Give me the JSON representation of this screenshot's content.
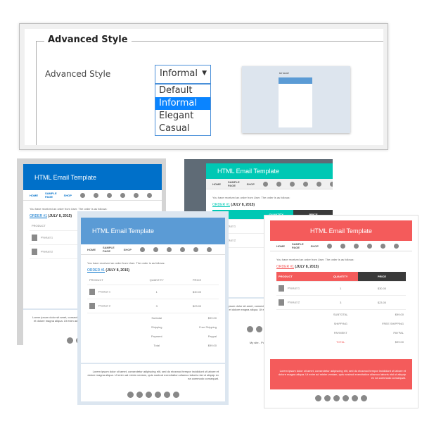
{
  "settings": {
    "legend": "Advanced Style",
    "label": "Advanced Style",
    "selected": "Informal",
    "options": [
      "Default",
      "Informal",
      "Elegant",
      "Casual"
    ],
    "preview_shop": "MY SHOP"
  },
  "email": {
    "title": "HTML Email Template",
    "nav": [
      "HOME",
      "SAMPLE PAGE",
      "SHOP"
    ],
    "social_icons": [
      "facebook-icon",
      "twitter-icon",
      "google-plus-icon",
      "email-icon",
      "instagram-icon",
      "flickr-icon"
    ],
    "intro": "You have received an order from User. The order is as follows:",
    "order_link": "ORDER #1",
    "order_date": "(JULY 8, 2015)",
    "headers": [
      "PRODUCT",
      "QUANTITY",
      "PRICE"
    ],
    "products": [
      {
        "name": "Product 1",
        "qty": "1",
        "price": "$30.00"
      },
      {
        "name": "Product 2",
        "qty": "3",
        "price": "$23.00"
      }
    ],
    "totals": [
      {
        "label": "Subtotal",
        "value": "$99.00"
      },
      {
        "label": "Shipping",
        "value": "Free Shipping"
      },
      {
        "label": "Payment",
        "value": "Paypal"
      },
      {
        "label": "Total",
        "value": "$99.00"
      }
    ],
    "footer": "Lorem ipsum dolor sit amet, consectetur adipiscing elit, sed do eiusmod tempor incididunt ut labore et dolore magna aliqua. Ut enim ad minim veniam, quis nostrud exercitation ullamco laboris nisi ut aliquip ex ea commodo consequat.",
    "site_footer": "My site - Powered by WooCommerce"
  },
  "colors": {
    "default": "#0070c9",
    "elegant": "#00c8b4",
    "informal": "#5b9bd5",
    "casual": "#f45b5b",
    "dark": "#3a3a3a"
  }
}
